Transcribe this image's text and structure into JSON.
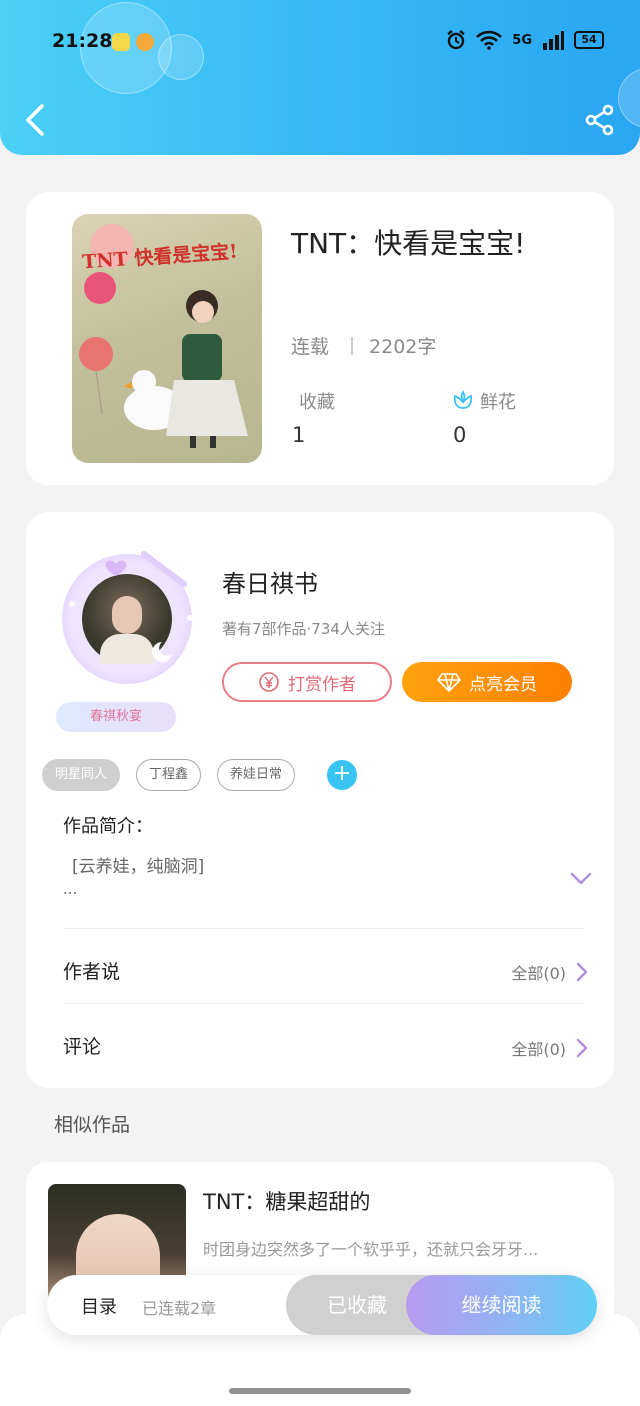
{
  "status_bar": {
    "time": "21:28",
    "network": "5G",
    "battery": "54"
  },
  "book": {
    "cover_text": "TNT 快看是宝宝!",
    "title": "TNT：快看是宝宝!",
    "status": "连载",
    "word_count": "2202字",
    "favorites_label": "收藏",
    "favorites_value": "1",
    "flowers_label": "鲜花",
    "flowers_value": "0"
  },
  "author": {
    "name": "春日祺书",
    "meta": "著有7部作品·734人关注",
    "badge": "春祺秋宴",
    "tip_label": "打赏作者",
    "vip_label": "点亮会员"
  },
  "tags": [
    "明星同人",
    "丁程鑫",
    "养娃日常"
  ],
  "intro": {
    "label": "作品简介：",
    "text": "[云养娃，纯脑洞]",
    "more": "..."
  },
  "author_says": {
    "label": "作者说",
    "all": "全部(0)"
  },
  "comments": {
    "label": "评论",
    "all": "全部(0)"
  },
  "similar": {
    "section_title": "相似作品",
    "items": [
      {
        "title": "TNT：糖果超甜的",
        "desc": "时团身边突然多了一个软乎乎，还就只会牙牙..."
      }
    ]
  },
  "action_bar": {
    "toc": "目录",
    "chapters": "已连载2章",
    "favorited": "已收藏",
    "continue": "继续阅读"
  },
  "colors": {
    "header": "#35b8f5",
    "vip": "#ff8f00",
    "tip": "#e97d88",
    "accent": "#38c3f3"
  },
  "icons": [
    "back-icon",
    "share-icon",
    "flower-icon",
    "yen-icon",
    "diamond-icon",
    "plus-icon",
    "chevron-down-icon",
    "chevron-right-icon"
  ]
}
